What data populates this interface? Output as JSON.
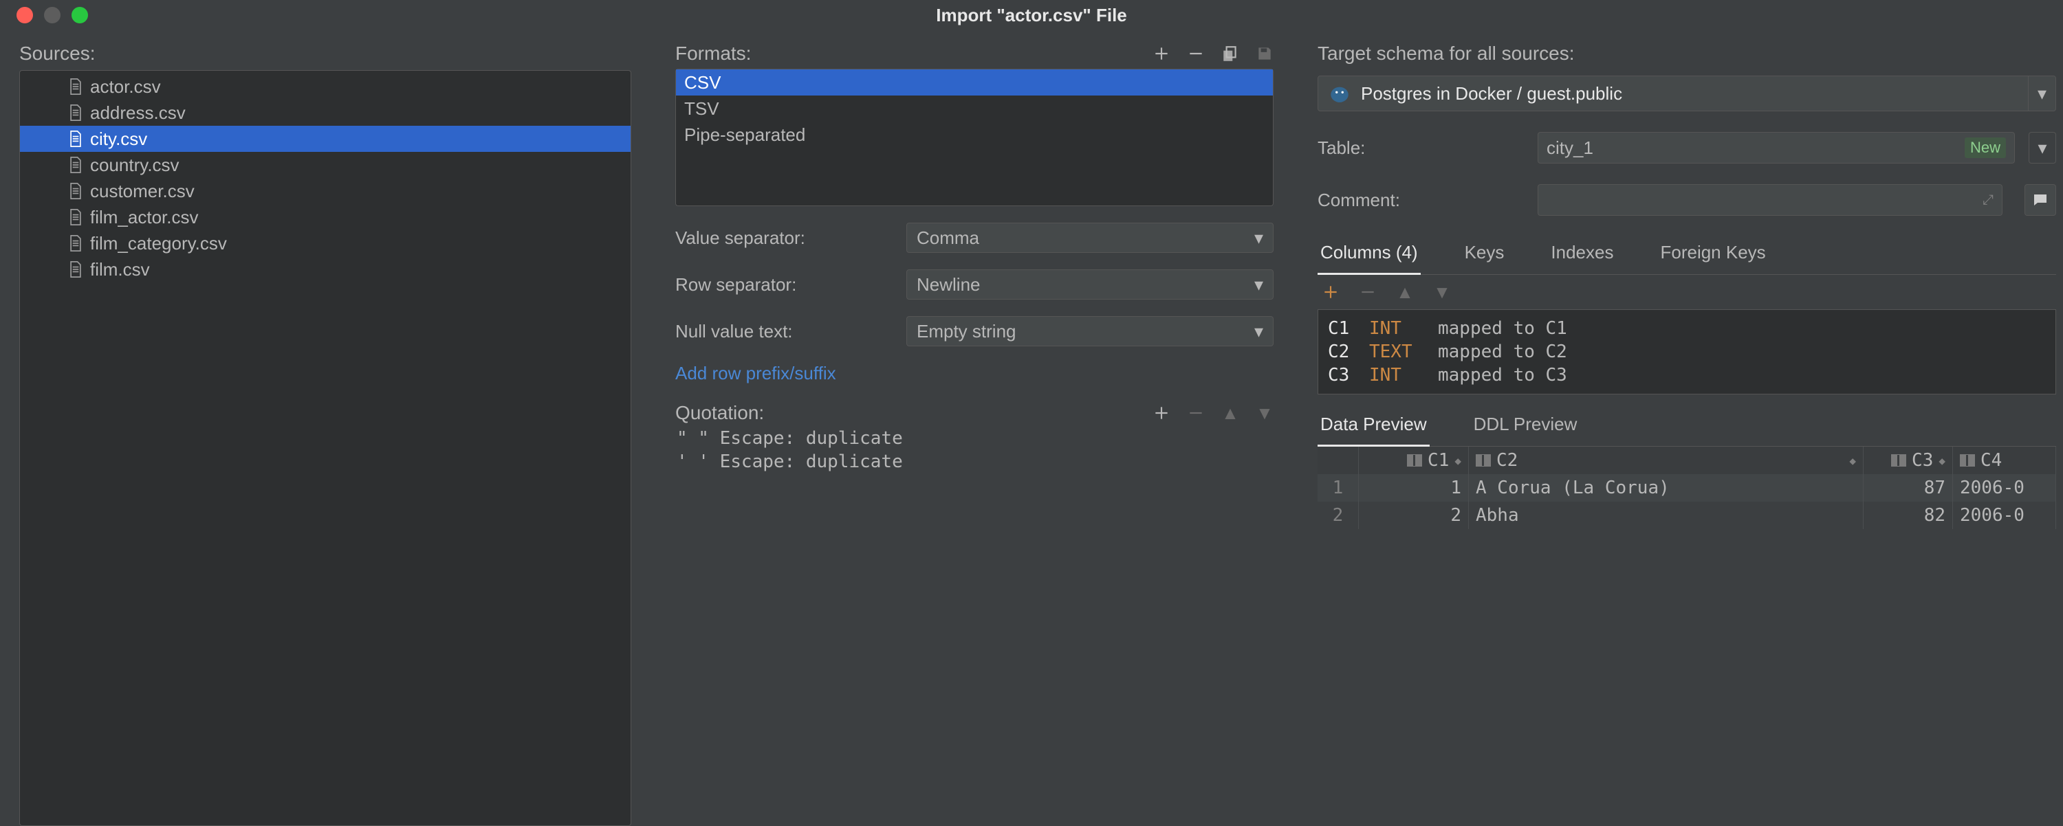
{
  "window_title": "Import \"actor.csv\" File",
  "sources_label": "Sources:",
  "sources": [
    {
      "name": "actor.csv",
      "selected": false
    },
    {
      "name": "address.csv",
      "selected": false
    },
    {
      "name": "city.csv",
      "selected": true
    },
    {
      "name": "country.csv",
      "selected": false
    },
    {
      "name": "customer.csv",
      "selected": false
    },
    {
      "name": "film_actor.csv",
      "selected": false
    },
    {
      "name": "film_category.csv",
      "selected": false
    },
    {
      "name": "film.csv",
      "selected": false
    }
  ],
  "formats_label": "Formats:",
  "formats": [
    {
      "name": "CSV",
      "selected": true
    },
    {
      "name": "TSV",
      "selected": false
    },
    {
      "name": "Pipe-separated",
      "selected": false
    }
  ],
  "value_separator": {
    "label": "Value separator:",
    "value": "Comma"
  },
  "row_separator": {
    "label": "Row separator:",
    "value": "Newline"
  },
  "null_value_text": {
    "label": "Null value text:",
    "value": "Empty string"
  },
  "add_row_prefix_suffix": "Add row prefix/suffix",
  "quotation_label": "Quotation:",
  "quotations": [
    "\" \"  Escape: duplicate",
    "' '  Escape: duplicate"
  ],
  "target_schema_label": "Target schema for all sources:",
  "target_schema_value": "Postgres in Docker / guest.public",
  "table_label": "Table:",
  "table_value": "city_1",
  "table_badge": "New",
  "comment_label": "Comment:",
  "comment_value": "",
  "col_tabs": [
    {
      "label": "Columns (4)",
      "active": true
    },
    {
      "label": "Keys",
      "active": false
    },
    {
      "label": "Indexes",
      "active": false
    },
    {
      "label": "Foreign Keys",
      "active": false
    }
  ],
  "columns_map": [
    {
      "name": "C1",
      "type": "INT",
      "map": "mapped to C1"
    },
    {
      "name": "C2",
      "type": "TEXT",
      "map": "mapped to C2"
    },
    {
      "name": "C3",
      "type": "INT",
      "map": "mapped to C3"
    }
  ],
  "preview_tabs": [
    {
      "label": "Data Preview",
      "active": true
    },
    {
      "label": "DDL Preview",
      "active": false
    }
  ],
  "grid_headers": [
    "C1",
    "C2",
    "C3",
    "C4"
  ],
  "grid_rows": [
    {
      "n": "1",
      "c1": "1",
      "c2": "A Corua (La Corua)",
      "c3": "87",
      "c4": "2006-0"
    },
    {
      "n": "2",
      "c1": "2",
      "c2": "Abha",
      "c3": "82",
      "c4": "2006-0"
    }
  ]
}
